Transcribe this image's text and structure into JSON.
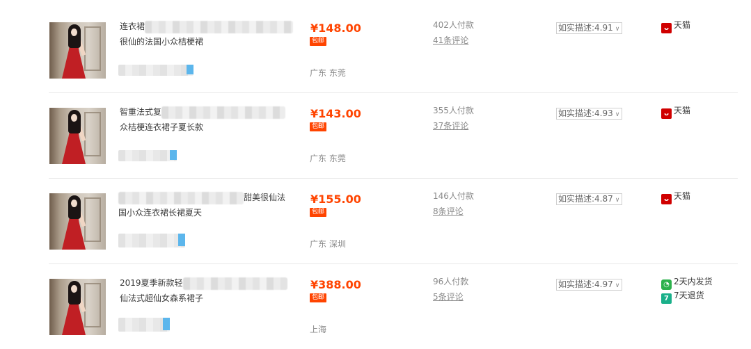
{
  "products": [
    {
      "title_line1_prefix": "连衣裙",
      "title_line2": "很仙的法国小众桔梗裙",
      "price": "¥148.00",
      "free_shipping": "包邮",
      "location": "广东 东莞",
      "paid_count": "402人付款",
      "review_count": "41条评论",
      "rating_label": "如实描述:",
      "rating_value": "4.91",
      "services": [
        {
          "icon": "tmall-icon",
          "label": "天猫"
        }
      ]
    },
    {
      "title_line1_prefix": "智重法式复",
      "title_line2": "众桔梗连衣裙子夏长款",
      "price": "¥143.00",
      "free_shipping": "包邮",
      "location": "广东 东莞",
      "paid_count": "355人付款",
      "review_count": "37条评论",
      "rating_label": "如实描述:",
      "rating_value": "4.93",
      "services": [
        {
          "icon": "tmall-icon",
          "label": "天猫"
        }
      ]
    },
    {
      "title_line1_suffix": "甜美很仙法",
      "title_line2": "国小众连衣裙长裙夏天",
      "price": "¥155.00",
      "free_shipping": "包邮",
      "location": "广东 深圳",
      "paid_count": "146人付款",
      "review_count": "8条评论",
      "rating_label": "如实描述:",
      "rating_value": "4.87",
      "services": [
        {
          "icon": "tmall-icon",
          "label": "天猫"
        }
      ]
    },
    {
      "title_line1_prefix": "2019夏季新款轻",
      "title_line2": "仙法式超仙女森系裙子",
      "price": "¥388.00",
      "free_shipping": "包邮",
      "location": "上海",
      "paid_count": "96人付款",
      "review_count": "5条评论",
      "rating_label": "如实描述:",
      "rating_value": "4.97",
      "services": [
        {
          "icon": "two-day-ship-icon",
          "label": "2天内发货"
        },
        {
          "icon": "seven-day-return-icon",
          "label": "7天退货"
        }
      ]
    }
  ],
  "colors": {
    "price": "#ff4400",
    "tmall": "#d00000",
    "muted_text": "#888888"
  }
}
